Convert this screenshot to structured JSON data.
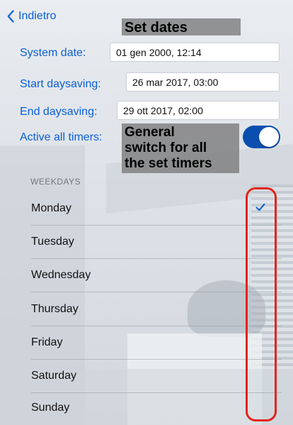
{
  "nav": {
    "back_label": "Indietro"
  },
  "annotations": {
    "set_dates": "Set dates",
    "general_switch": [
      "General",
      "switch for all",
      "the set timers"
    ]
  },
  "settings": {
    "system_date": {
      "label": "System date:",
      "value": "01 gen 2000, 12:14"
    },
    "start_daysaving": {
      "label": "Start daysaving:",
      "value": "26 mar 2017, 03:00"
    },
    "end_daysaving": {
      "label": "End daysaving:",
      "value": "29 ott 2017, 02:00"
    },
    "active_timers": {
      "label": "Active all timers:",
      "on": true
    }
  },
  "weekdays": {
    "header": "WEEKDAYS",
    "days": [
      {
        "name": "Monday",
        "checked": true
      },
      {
        "name": "Tuesday",
        "checked": false
      },
      {
        "name": "Wednesday",
        "checked": false
      },
      {
        "name": "Thursday",
        "checked": false
      },
      {
        "name": "Friday",
        "checked": false
      },
      {
        "name": "Saturday",
        "checked": false
      },
      {
        "name": "Sunday",
        "checked": false
      }
    ]
  },
  "colors": {
    "accent": "#0a5fd6",
    "toggle_on": "#0a4fb0",
    "highlight": "#e2241b",
    "annotation_bg": "#787878"
  }
}
